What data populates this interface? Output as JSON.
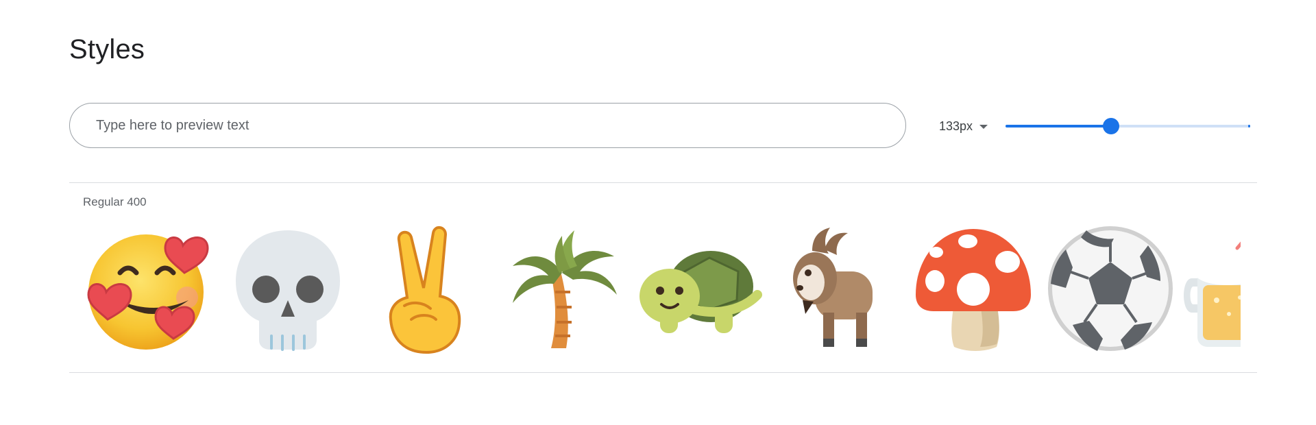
{
  "page": {
    "title": "Styles"
  },
  "preview": {
    "placeholder": "Type here to preview text",
    "value": ""
  },
  "size_control": {
    "selected": "133px",
    "slider_fraction": 0.43
  },
  "style": {
    "label": "Regular 400"
  },
  "glyphs": [
    {
      "name": "smiling-face-with-hearts-icon"
    },
    {
      "name": "skull-icon"
    },
    {
      "name": "victory-hand-icon"
    },
    {
      "name": "palm-tree-icon"
    },
    {
      "name": "turtle-icon"
    },
    {
      "name": "goat-icon"
    },
    {
      "name": "mushroom-icon"
    },
    {
      "name": "soccer-ball-icon"
    },
    {
      "name": "beer-mug-icon"
    }
  ],
  "colors": {
    "accent": "#1a73e8",
    "track": "#cfe0f6",
    "divider": "#dadce0"
  }
}
